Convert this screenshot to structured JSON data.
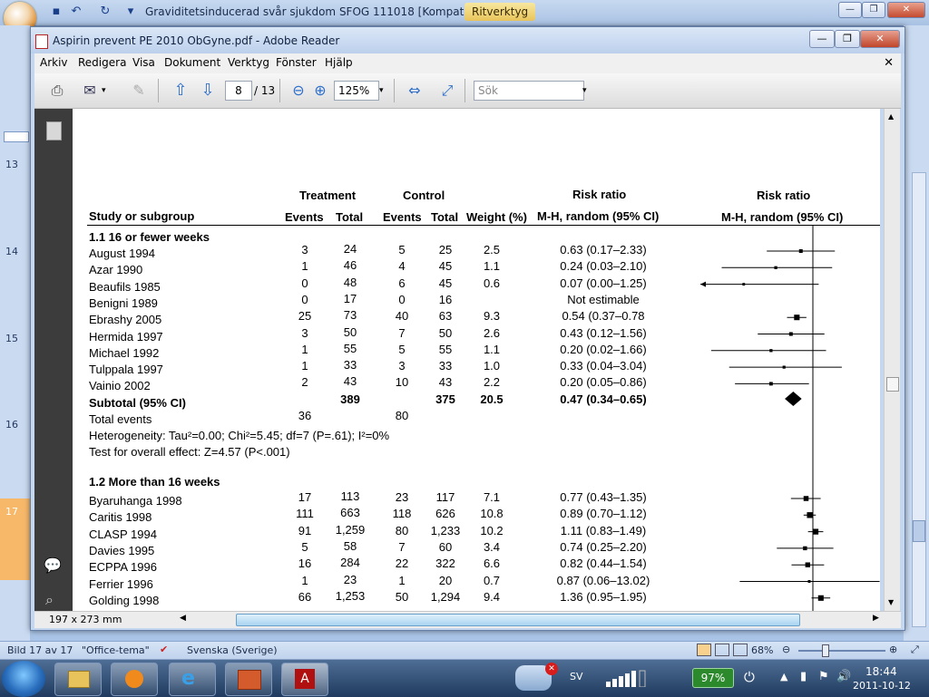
{
  "ppt": {
    "title": "Graviditetsinducerad svår sjukdom SFOG 111018 [Kompatibilite...",
    "context_tab": "Ritverktyg",
    "slide_numbers": [
      "13",
      "14",
      "15",
      "16",
      "17"
    ],
    "status_slide": "Bild 17 av 17",
    "status_theme": "\"Office-tema\"",
    "status_lang": "Svenska (Sverige)",
    "zoom": "68%"
  },
  "reader": {
    "title": "Aspirin prevent PE 2010 ObGyne.pdf - Adobe Reader",
    "menu": [
      "Arkiv",
      "Redigera",
      "Visa",
      "Dokument",
      "Verktyg",
      "Fönster",
      "Hjälp"
    ],
    "page_current": "8",
    "page_total": "/ 13",
    "zoom": "125%",
    "search_placeholder": "Sök",
    "page_size": "197 x 273 mm"
  },
  "forest": {
    "hdr_treatment": "Treatment",
    "hdr_control": "Control",
    "hdr_rr": "Risk ratio",
    "hdr_rr2": "Risk ratio",
    "hdr_study": "Study or subgroup",
    "hdr_events1": "Events",
    "hdr_total1": "Total",
    "hdr_events2": "Events",
    "hdr_total2": "Total",
    "hdr_weight": "Weight (%)",
    "hdr_mh": "M-H, random (95% CI)",
    "hdr_mh2": "M-H, random (95% CI)",
    "group1": "1.1 16 or fewer weeks",
    "rows1": [
      {
        "study": "August 1994",
        "te": "3",
        "tt": "24",
        "ce": "5",
        "ct": "25",
        "w": "2.5",
        "rr": "0.63 (0.17–2.33)"
      },
      {
        "study": "Azar 1990",
        "te": "1",
        "tt": "46",
        "ce": "4",
        "ct": "45",
        "w": "1.1",
        "rr": "0.24 (0.03–2.10)"
      },
      {
        "study": "Beaufils 1985",
        "te": "0",
        "tt": "48",
        "ce": "6",
        "ct": "45",
        "w": "0.6",
        "rr": "0.07 (0.00–1.25)"
      },
      {
        "study": "Benigni 1989",
        "te": "0",
        "tt": "17",
        "ce": "0",
        "ct": "16",
        "w": "",
        "rr": "Not estimable"
      },
      {
        "study": "Ebrashy 2005",
        "te": "25",
        "tt": "73",
        "ce": "40",
        "ct": "63",
        "w": "9.3",
        "rr": "0.54 (0.37–0.78"
      },
      {
        "study": "Hermida 1997",
        "te": "3",
        "tt": "50",
        "ce": "7",
        "ct": "50",
        "w": "2.6",
        "rr": "0.43 (0.12–1.56)"
      },
      {
        "study": "Michael 1992",
        "te": "1",
        "tt": "55",
        "ce": "5",
        "ct": "55",
        "w": "1.1",
        "rr": "0.20 (0.02–1.66)"
      },
      {
        "study": "Tulppala 1997",
        "te": "1",
        "tt": "33",
        "ce": "3",
        "ct": "33",
        "w": "1.0",
        "rr": "0.33 (0.04–3.04)"
      },
      {
        "study": "Vainio 2002",
        "te": "2",
        "tt": "43",
        "ce": "10",
        "ct": "43",
        "w": "2.2",
        "rr": "0.20 (0.05–0.86)"
      }
    ],
    "subtotal_label": "Subtotal (95% CI)",
    "subtotal_tt": "389",
    "subtotal_ct": "375",
    "subtotal_w": "20.5",
    "subtotal_rr": "0.47 (0.34–0.65)",
    "total_events_label": "Total events",
    "total_events_t": "36",
    "total_events_c": "80",
    "heterogeneity": "Heterogeneity: Tau²=0.00; Chi²=5.45; df=7 (P=.61); I²=0%",
    "overall": "Test for overall effect: Z=4.57 (P<.001)",
    "group2": "1.2 More than 16 weeks",
    "rows2": [
      {
        "study": "Byaruhanga 1998",
        "te": "17",
        "tt": "113",
        "ce": "23",
        "ct": "117",
        "w": "7.1",
        "rr": "0.77 (0.43–1.35)"
      },
      {
        "study": "Caritis 1998",
        "te": "111",
        "tt": "663",
        "ce": "118",
        "ct": "626",
        "w": "10.8",
        "rr": "0.89 (0.70–1.12)"
      },
      {
        "study": "CLASP 1994",
        "te": "91",
        "tt": "1,259",
        "ce": "80",
        "ct": "1,233",
        "w": "10.2",
        "rr": "1.11 (0.83–1.49)"
      },
      {
        "study": "Davies 1995",
        "te": "5",
        "tt": "58",
        "ce": "7",
        "ct": "60",
        "w": "3.4",
        "rr": "0.74 (0.25–2.20)"
      },
      {
        "study": "ECPPA 1996",
        "te": "16",
        "tt": "284",
        "ce": "22",
        "ct": "322",
        "w": "6.6",
        "rr": "0.82 (0.44–1.54)"
      },
      {
        "study": "Ferrier 1996",
        "te": "1",
        "tt": "23",
        "ce": "1",
        "ct": "20",
        "w": "0.7",
        "rr": "0.87 (0.06–13.02)"
      },
      {
        "study": "Golding 1998",
        "te": "66",
        "tt": "1,253",
        "ce": "50",
        "ct": "1,294",
        "w": "9.4",
        "rr": "1.36 (0.95–1.95)"
      }
    ]
  },
  "taskbar": {
    "lang": "SV",
    "battery": "97%",
    "time": "18:44",
    "date": "2011-10-12"
  }
}
